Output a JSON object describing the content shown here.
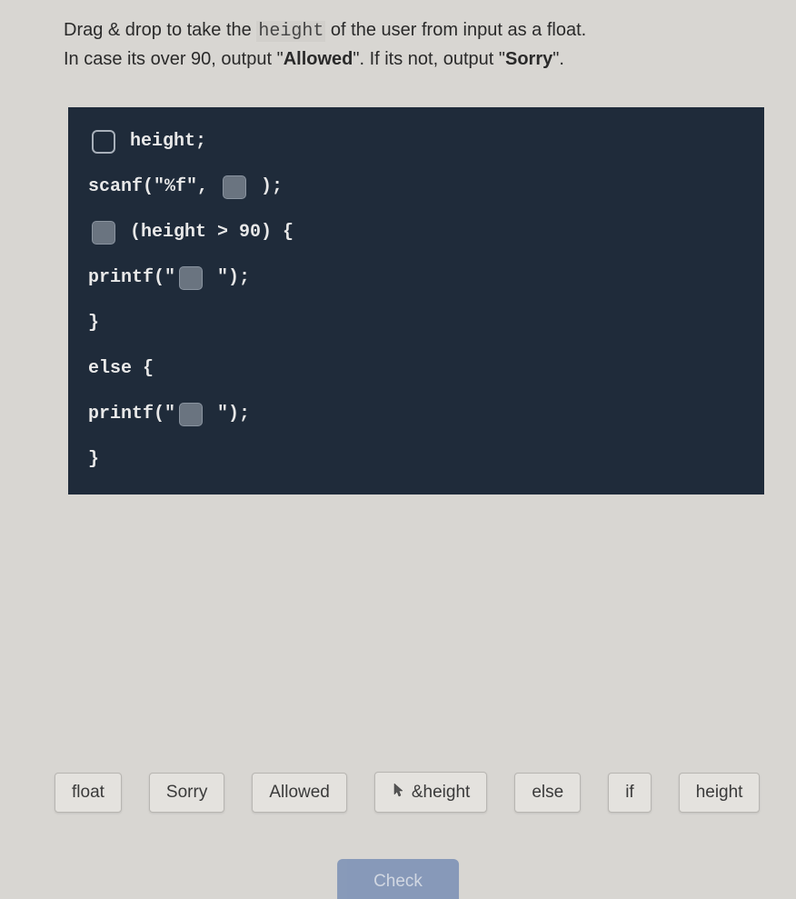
{
  "instructions": {
    "line1_pre": "Drag & drop to take the ",
    "line1_code": "height",
    "line1_post": " of the user from input as a float.",
    "line2_pre": "In case its over 90, output \"",
    "line2_bold1": "Allowed",
    "line2_mid": "\". If its not, output \"",
    "line2_bold2": "Sorry",
    "line2_post": "\"."
  },
  "code": {
    "l1_after": " height;",
    "l2_before": "scanf(\"%f\", ",
    "l2_after": " );",
    "l3_after": " (height > 90) {",
    "l4_before": "printf(\"",
    "l4_after": " \");",
    "l5": "}",
    "l6": "else {",
    "l7_before": "printf(\"",
    "l7_after": " \");",
    "l8": "}"
  },
  "options": {
    "o1": "float",
    "o2": "Sorry",
    "o3": "Allowed",
    "o4": "&height",
    "o5": "else",
    "o6": "if",
    "o7": "height"
  },
  "buttons": {
    "check": "Check"
  }
}
